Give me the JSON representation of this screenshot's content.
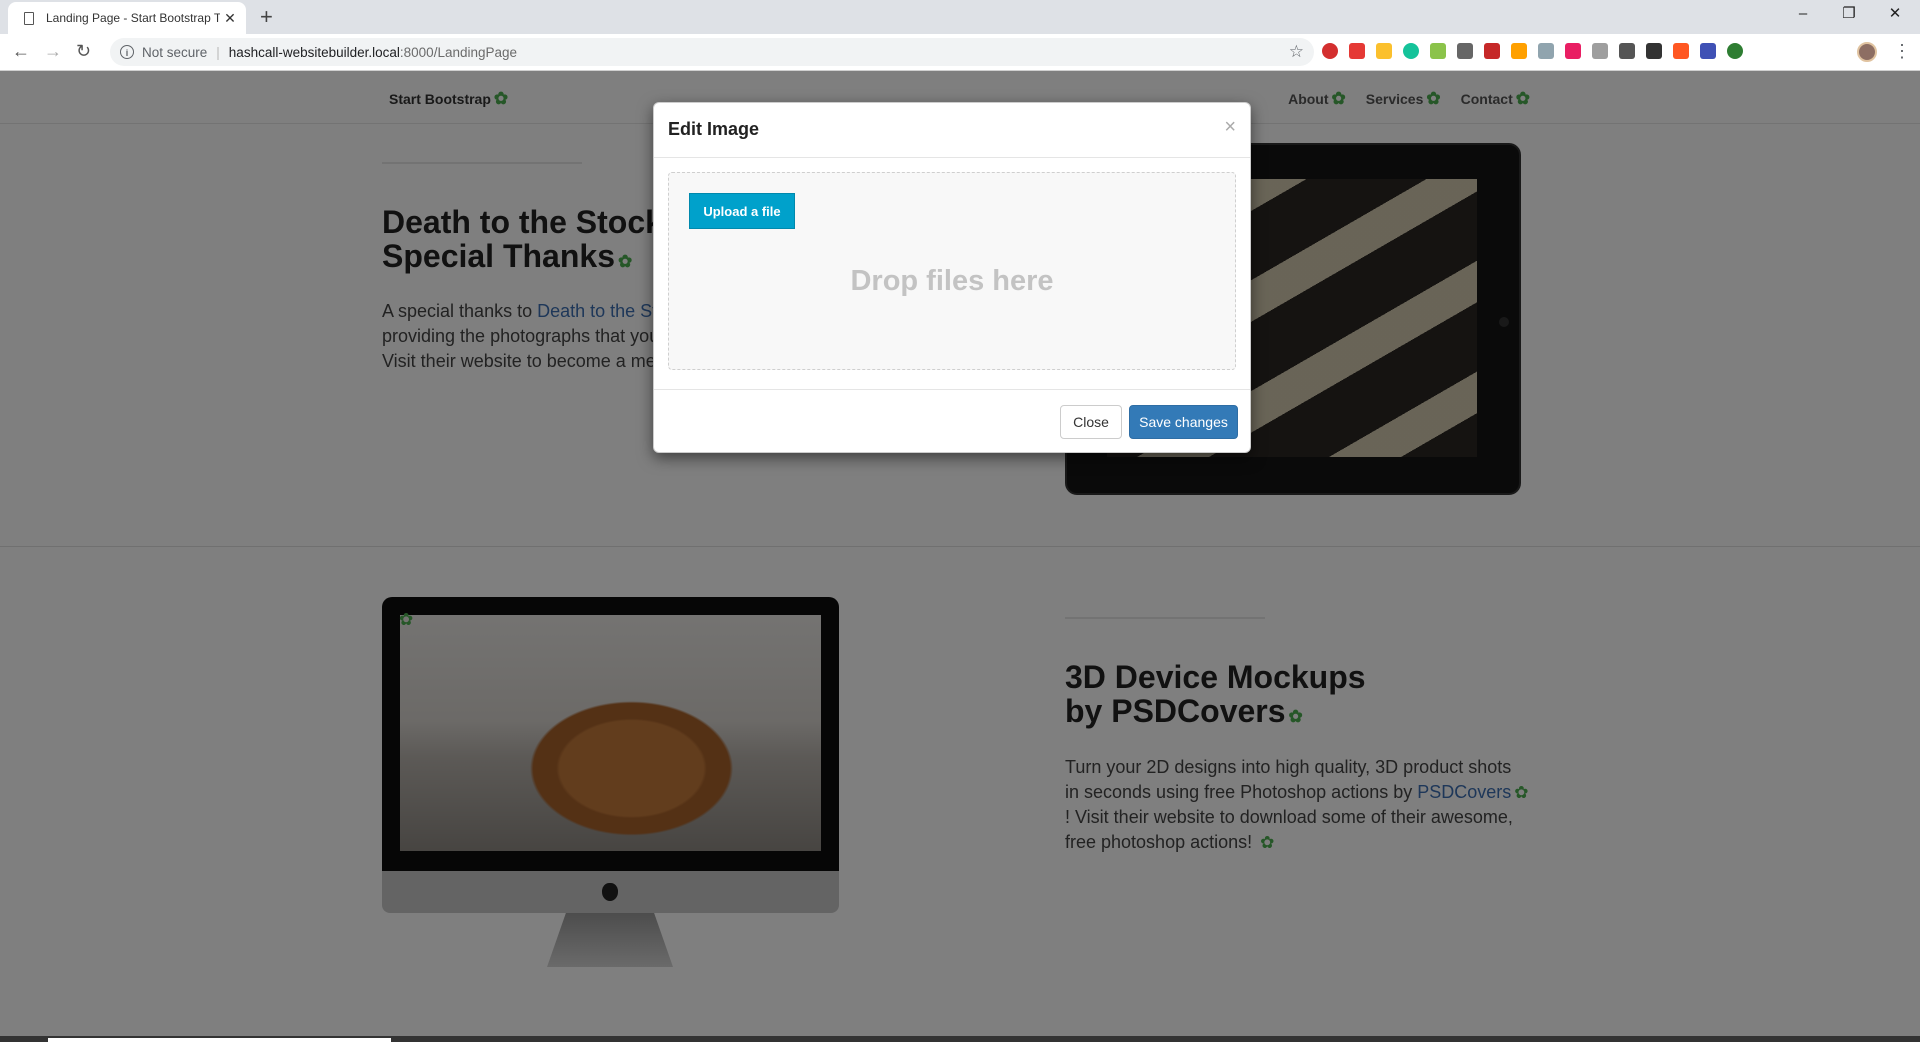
{
  "browser": {
    "tab_title": "Landing Page - Start Bootstrap Th",
    "new_tab": "+",
    "address_security": "Not secure",
    "address_host": "hashcall-websitebuilder.local",
    "address_path": ":8000/LandingPage",
    "window_controls": [
      "–",
      "❐",
      "✕"
    ],
    "extensions": [
      "opera-icon",
      "red-square-icon",
      "yellow-badge-icon",
      "grammarly-icon",
      "green-mail-icon",
      "copy-icon",
      "red-chart-icon",
      "bulb-icon",
      "eye-icon",
      "colorwheel-icon",
      "gray-square-icon",
      "info-icon",
      "glasses-icon",
      "rainbow-icon",
      "hash-icon",
      "green-circle-icon"
    ],
    "extension_colors": [
      "#d32f2f",
      "#e53935",
      "#fbc02d",
      "#15c39a",
      "#8bc34a",
      "#666666",
      "#c62828",
      "#ffa000",
      "#90a4ae",
      "#e91e63",
      "#9e9e9e",
      "#555555",
      "#333333",
      "#ff5722",
      "#3f51b5",
      "#2e7d32"
    ]
  },
  "site": {
    "brand": "Start Bootstrap",
    "nav": [
      "About",
      "Services",
      "Contact"
    ],
    "gear_glyph": "✿",
    "section1": {
      "heading_line1": "Death to the Stock P",
      "heading_line2": "Special Thanks",
      "text_prefix": "A special thanks to ",
      "link": "Death to the St",
      "text_line2": "providing the photographs that you",
      "text_line3": "Visit their website to become a mer"
    },
    "section2": {
      "heading_line1": "3D Device Mockups",
      "heading_line2": "by PSDCovers",
      "text1": "Turn your 2D designs into high quality, 3D product shots in seconds using free Photoshop actions by ",
      "link": "PSDCovers",
      "text2": "! Visit their website to download some of their awesome, free photoshop actions! "
    }
  },
  "modal": {
    "title": "Edit Image",
    "close_x": "×",
    "upload_label": "Upload a file",
    "drop_text": "Drop files here",
    "close_label": "Close",
    "save_label": "Save changes"
  }
}
